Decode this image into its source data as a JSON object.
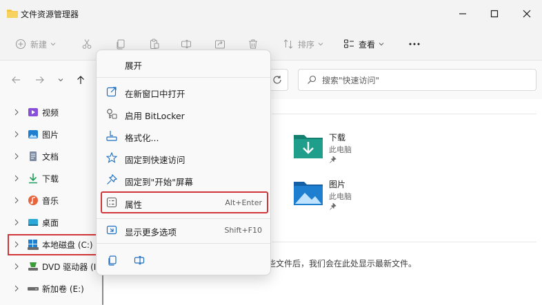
{
  "window": {
    "title": "文件资源管理器"
  },
  "toolbar": {
    "new_label": "新建",
    "sort_label": "排序",
    "view_label": "查看",
    "more_label": "···"
  },
  "search": {
    "placeholder": "搜索\"快速访问\""
  },
  "sidebar": {
    "items": [
      {
        "label": "视频",
        "icon": "video-icon"
      },
      {
        "label": "图片",
        "icon": "pictures-icon"
      },
      {
        "label": "文档",
        "icon": "documents-icon"
      },
      {
        "label": "下载",
        "icon": "download-icon"
      },
      {
        "label": "音乐",
        "icon": "music-icon"
      },
      {
        "label": "桌面",
        "icon": "desktop-icon"
      },
      {
        "label": "本地磁盘 (C:)",
        "icon": "local-disk-icon"
      },
      {
        "label": "DVD 驱动器 (I",
        "icon": "dvd-drive-icon"
      },
      {
        "label": "新加卷 (E:)",
        "icon": "volume-drive-icon"
      }
    ]
  },
  "main": {
    "folders": [
      {
        "name": "下载",
        "location": "此电脑"
      },
      {
        "name": "图片",
        "location": "此电脑"
      }
    ],
    "recent_note": "些文件后，我们会在此处显示最新文件。"
  },
  "context_menu": {
    "expand": "展开",
    "items": [
      {
        "label": "在新窗口中打开",
        "icon": "open-new-window-icon"
      },
      {
        "label": "启用 BitLocker",
        "icon": "bitlocker-key-icon"
      },
      {
        "label": "格式化...",
        "icon": "format-icon"
      },
      {
        "label": "固定到快速访问",
        "icon": "star-icon"
      },
      {
        "label": "固定到\"开始\"屏幕",
        "icon": "pin-icon"
      }
    ],
    "properties": {
      "label": "属性",
      "shortcut": "Alt+Enter"
    },
    "more_options": {
      "label": "显示更多选项",
      "shortcut": "Shift+F10"
    }
  },
  "colors": {
    "highlight": "#d13438",
    "folder_teal": "#1f9e8c",
    "folder_blue": "#1e7fd0"
  }
}
